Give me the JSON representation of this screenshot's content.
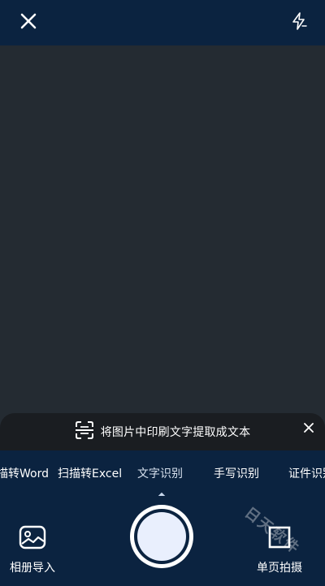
{
  "topbar": {
    "close_icon": "close-icon",
    "flash_icon": "flash-auto-icon"
  },
  "hint": {
    "text": "将图片中印刷文字提取成文本",
    "icon": "scan-text-icon",
    "close_icon": "close-icon"
  },
  "modes": {
    "items": [
      {
        "label": "描转Word"
      },
      {
        "label": "扫描转Excel"
      },
      {
        "label": "文字识别",
        "active": true
      },
      {
        "label": "手写识别"
      },
      {
        "label": "证件识别"
      }
    ]
  },
  "bottom": {
    "album_label": "相册导入",
    "album_icon": "image-import-icon",
    "single_page_label": "单页拍摄",
    "single_page_icon": "square-icon"
  },
  "watermark": {
    "text": "日天软件"
  },
  "colors": {
    "bar_bg": "#0b2340",
    "viewfinder_bg": "#242b32",
    "banner_bg": "#1a1d21",
    "shutter_fill": "#e9effd"
  }
}
